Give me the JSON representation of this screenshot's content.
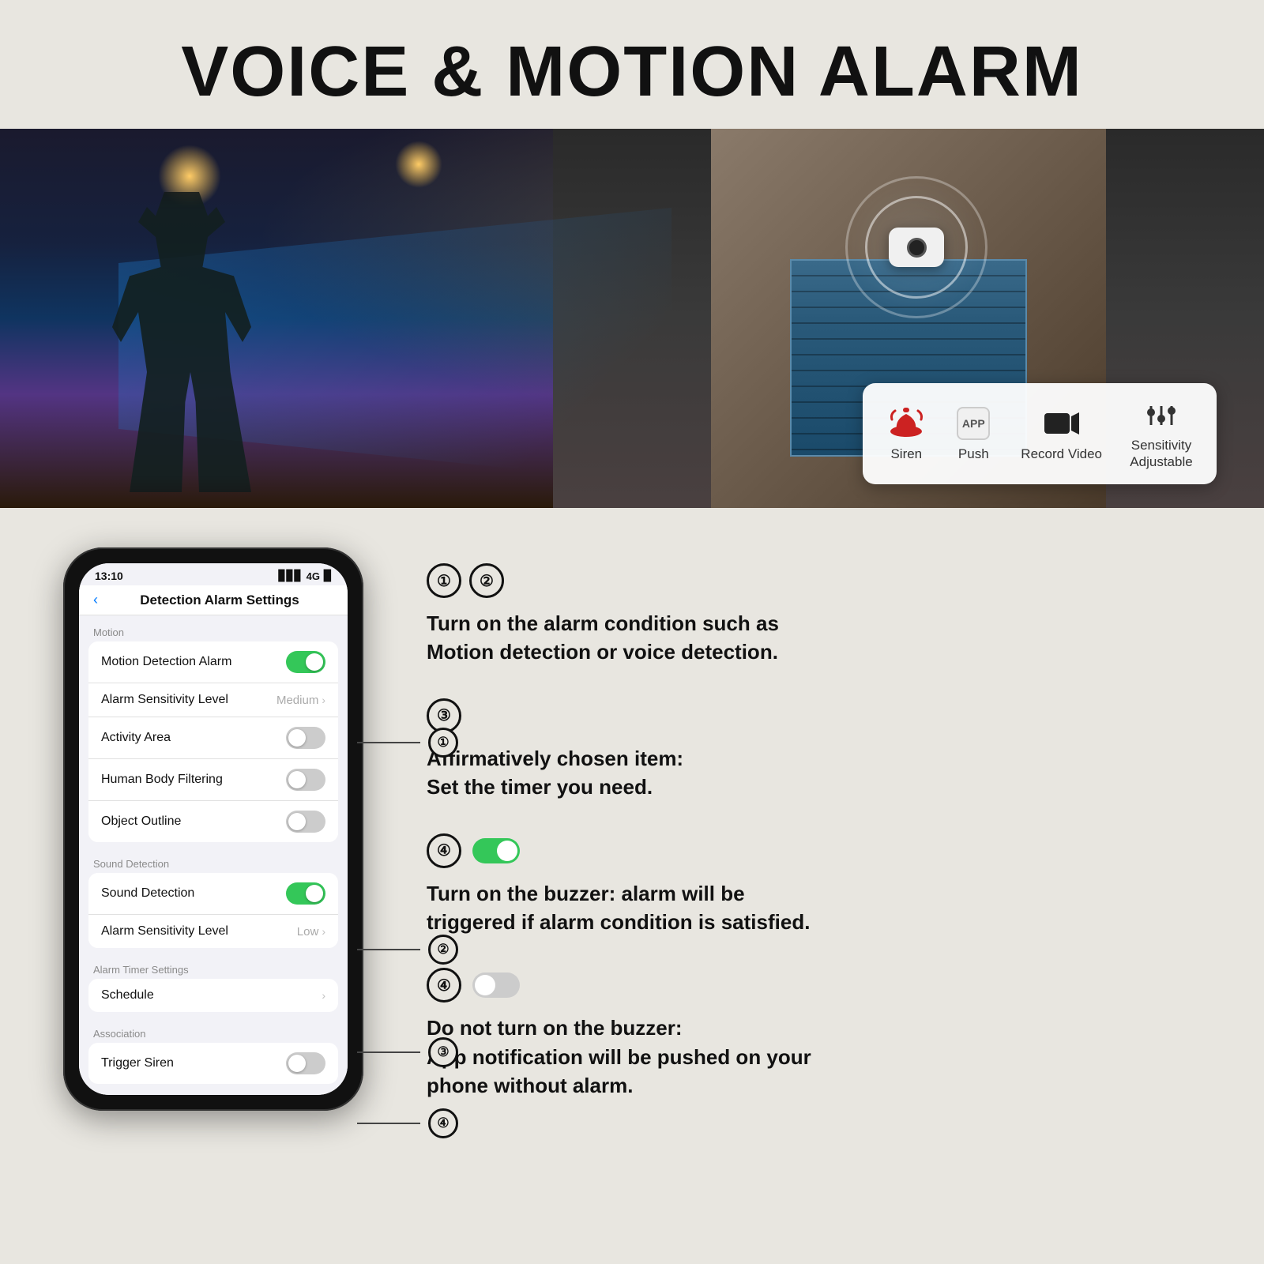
{
  "page": {
    "title": "VOICE & MOTION ALARM",
    "background_color": "#e8e6e0"
  },
  "hero": {
    "toolbar": {
      "items": [
        {
          "id": "siren",
          "label": "Siren",
          "icon": "siren"
        },
        {
          "id": "push",
          "label": "Push",
          "icon": "app"
        },
        {
          "id": "record_video",
          "label": "Record Video",
          "icon": "video"
        },
        {
          "id": "sensitivity_adjustable",
          "label": "Sensitivity Adjustable",
          "icon": "sliders"
        }
      ]
    }
  },
  "phone": {
    "status_bar": {
      "time": "13:10",
      "signal": "📶",
      "network": "4G",
      "battery": "🔋"
    },
    "nav_title": "Detection Alarm Settings",
    "back_label": "‹",
    "sections": [
      {
        "header": "Motion",
        "rows": [
          {
            "label": "Motion Detection Alarm",
            "type": "toggle",
            "state": "on"
          },
          {
            "label": "Alarm Sensitivity Level",
            "type": "value",
            "value": "Medium"
          },
          {
            "label": "Activity Area",
            "type": "toggle",
            "state": "off"
          },
          {
            "label": "Human Body Filtering",
            "type": "toggle",
            "state": "off"
          },
          {
            "label": "Object Outline",
            "type": "toggle",
            "state": "off"
          }
        ]
      },
      {
        "header": "Sound Detection",
        "rows": [
          {
            "label": "Sound Detection",
            "type": "toggle",
            "state": "on"
          },
          {
            "label": "Alarm Sensitivity Level",
            "type": "value",
            "value": "Low"
          }
        ]
      },
      {
        "header": "Alarm Timer Settings",
        "rows": [
          {
            "label": "Schedule",
            "type": "arrow"
          }
        ]
      },
      {
        "header": "Association",
        "rows": [
          {
            "label": "Trigger Siren",
            "type": "toggle",
            "state": "off"
          }
        ]
      }
    ],
    "annotations": [
      {
        "num": "①",
        "row": "motion_detection_alarm"
      },
      {
        "num": "②",
        "row": "sound_detection"
      },
      {
        "num": "③",
        "row": "schedule"
      },
      {
        "num": "④",
        "row": "trigger_siren"
      }
    ]
  },
  "descriptions": [
    {
      "nums": [
        "①",
        "②"
      ],
      "text": "Turn on the alarm condition such as Motion detection or voice detection."
    },
    {
      "nums": [
        "③"
      ],
      "text": "Affirmatively chosen item:\nSet the timer you need."
    },
    {
      "nums": [
        "④"
      ],
      "toggle": "on",
      "text": "Turn on the buzzer: alarm will be triggered if alarm condition is satisfied."
    },
    {
      "nums": [
        "④"
      ],
      "toggle": "off",
      "text": "Do not turn on the buzzer:\nApp notification will be pushed on your phone without alarm."
    }
  ]
}
